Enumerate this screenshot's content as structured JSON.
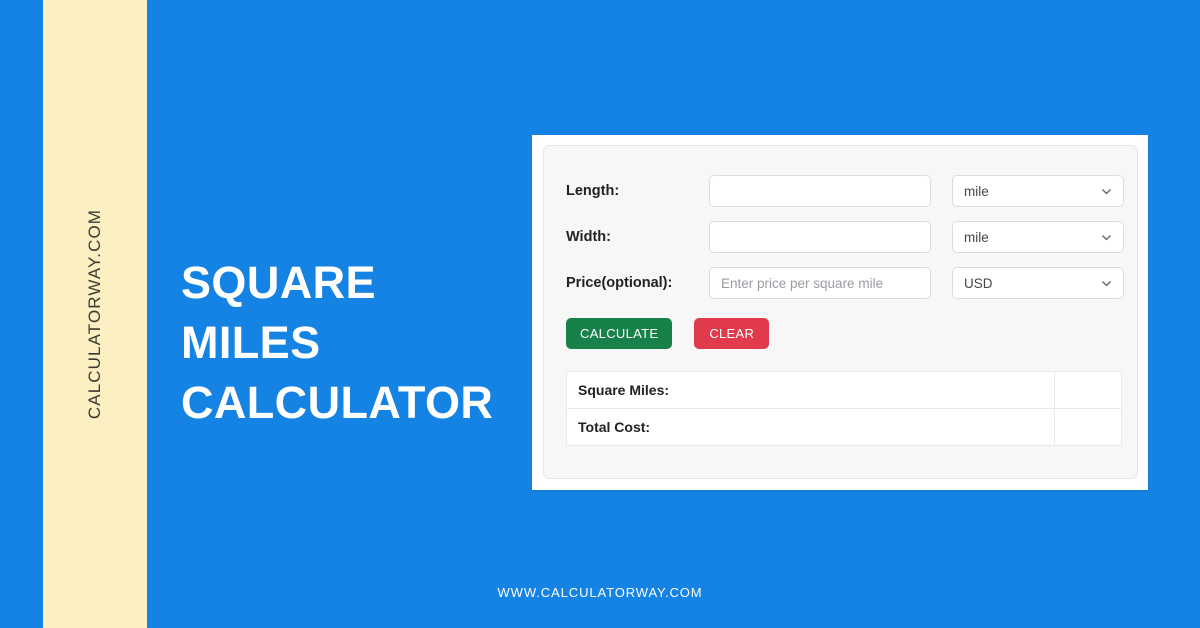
{
  "theme": {
    "background_blue": "#1583e3",
    "band_yellow": "#fcefc2",
    "card_white": "#ffffff",
    "panel_grey": "#f7f7f8",
    "calculate_green": "#18814a",
    "clear_red": "#e13a4c",
    "title_white": "#ffffff"
  },
  "brand": {
    "vertical_text": "CALCULATORWAY.COM"
  },
  "hero": {
    "title_line_1": "SQUARE MILES",
    "title_line_2": "CALCULATOR"
  },
  "form": {
    "rows": [
      {
        "label": "Length:",
        "input_value": "",
        "input_placeholder": "",
        "unit": "mile",
        "chevron_icon": "chevron-down-icon"
      },
      {
        "label": "Width:",
        "input_value": "",
        "input_placeholder": "",
        "unit": "mile",
        "chevron_icon": "chevron-down-icon"
      },
      {
        "label": "Price(optional):",
        "input_value": "",
        "input_placeholder": "Enter price per square mile",
        "unit": "USD",
        "chevron_icon": "chevron-down-icon"
      }
    ],
    "buttons": {
      "calculate_label": "CALCULATE",
      "clear_label": "CLEAR"
    }
  },
  "results": {
    "rows": [
      {
        "label": "Square Miles:",
        "value": ""
      },
      {
        "label": "Total Cost:",
        "value": ""
      }
    ]
  },
  "footer": {
    "url": "WWW.CALCULATORWAY.COM"
  }
}
